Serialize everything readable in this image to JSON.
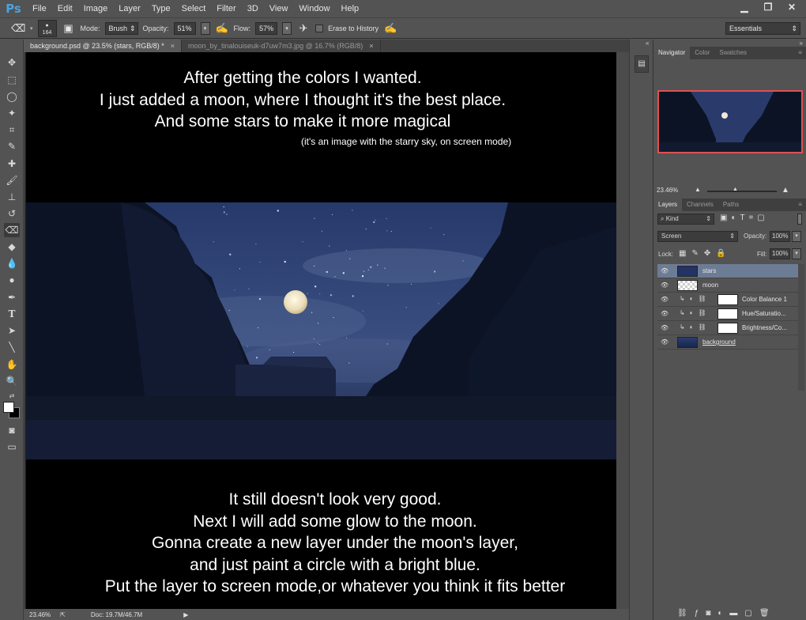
{
  "app": {
    "logo": "Ps"
  },
  "menu": [
    "File",
    "Edit",
    "Image",
    "Layer",
    "Type",
    "Select",
    "Filter",
    "3D",
    "View",
    "Window",
    "Help"
  ],
  "window_controls": {
    "minimize": "▁",
    "restore": "❐",
    "close": "✕"
  },
  "options_bar": {
    "brush_size": "164",
    "mode_label": "Mode:",
    "mode_value": "Brush",
    "opacity_label": "Opacity:",
    "opacity_value": "51%",
    "flow_label": "Flow:",
    "flow_value": "57%",
    "erase_history_label": "Erase to History",
    "workspace": "Essentials"
  },
  "tabs": [
    {
      "label": "background.psd @ 23.5% (stars, RGB/8) *",
      "active": true
    },
    {
      "label": "moon_by_tinalouiseuk-d7uw7m3.jpg @ 16.7% (RGB/8)",
      "active": false
    }
  ],
  "canvas": {
    "top_caption": [
      "After getting the colors I wanted.",
      "I just added a moon, where I thought it's the best place.",
      "And some stars to make it more magical"
    ],
    "top_note": "(it's an image with the starry sky, on  screen mode)",
    "bottom_caption": [
      "It still doesn't look very good.",
      "Next I will add some glow to the moon.",
      "Gonna create a new layer under the moon's layer,",
      "and just paint a circle with a bright blue.",
      "Put the layer to screen mode,or whatever you think it fits better"
    ]
  },
  "status": {
    "zoom": "23.46%",
    "doc": "Doc: 19.7M/46.7M"
  },
  "navigator": {
    "tabs": [
      "Navigator",
      "Color",
      "Swatches"
    ],
    "zoom": "23.46%"
  },
  "layers_panel": {
    "tabs": [
      "Layers",
      "Channels",
      "Paths"
    ],
    "filter": "Kind",
    "blend_mode": "Screen",
    "opacity_label": "Opacity:",
    "opacity_value": "100%",
    "lock_label": "Lock:",
    "fill_label": "Fill:",
    "fill_value": "100%",
    "layers": [
      {
        "name": "stars",
        "selected": true
      },
      {
        "name": "moon",
        "selected": false
      },
      {
        "name": "Color Balance 1",
        "selected": false
      },
      {
        "name": "Hue/Saturatio...",
        "selected": false
      },
      {
        "name": "Brightness/Co...",
        "selected": false
      },
      {
        "name": "background",
        "selected": false
      }
    ]
  },
  "colors": {
    "accent": "#4aa3df",
    "selected_layer": "#6d7c95",
    "nav_frame": "#e05050"
  }
}
